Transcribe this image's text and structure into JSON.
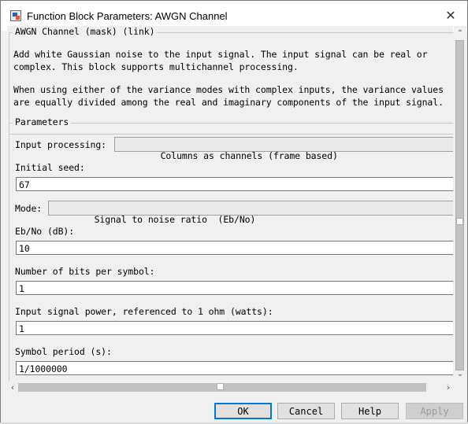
{
  "window": {
    "title": "Function Block Parameters: AWGN Channel",
    "close_glyph": "✕"
  },
  "description": {
    "legend": "AWGN Channel (mask) (link)",
    "lines": [
      "Add white Gaussian noise to the input signal. The input signal can be real or",
      "complex. This block supports multichannel processing.",
      "When using either of the variance modes with complex inputs, the variance values",
      "are equally divided among the real and imaginary components of the input signal."
    ]
  },
  "parameters": {
    "legend": "Parameters",
    "input_processing": {
      "label": "Input processing:",
      "value": "Columns as channels (frame based)"
    },
    "initial_seed": {
      "label": "Initial seed:",
      "value": "67"
    },
    "mode": {
      "label": "Mode:",
      "value": "Signal to noise ratio  (Eb/No)"
    },
    "ebno": {
      "label": "Eb/No (dB):",
      "value": "10"
    },
    "bits_per_symbol": {
      "label": "Number of bits per symbol:",
      "value": "1"
    },
    "signal_power": {
      "label": "Input signal power, referenced to 1 ohm (watts):",
      "value": "1"
    },
    "symbol_period": {
      "label": "Symbol period (s):",
      "value": "1/1000000"
    }
  },
  "scrollbars": {
    "up": "⌃",
    "down": "⌄",
    "left": "‹",
    "right": "›"
  },
  "buttons": {
    "ok": "OK",
    "cancel": "Cancel",
    "help": "Help",
    "apply": "Apply"
  }
}
